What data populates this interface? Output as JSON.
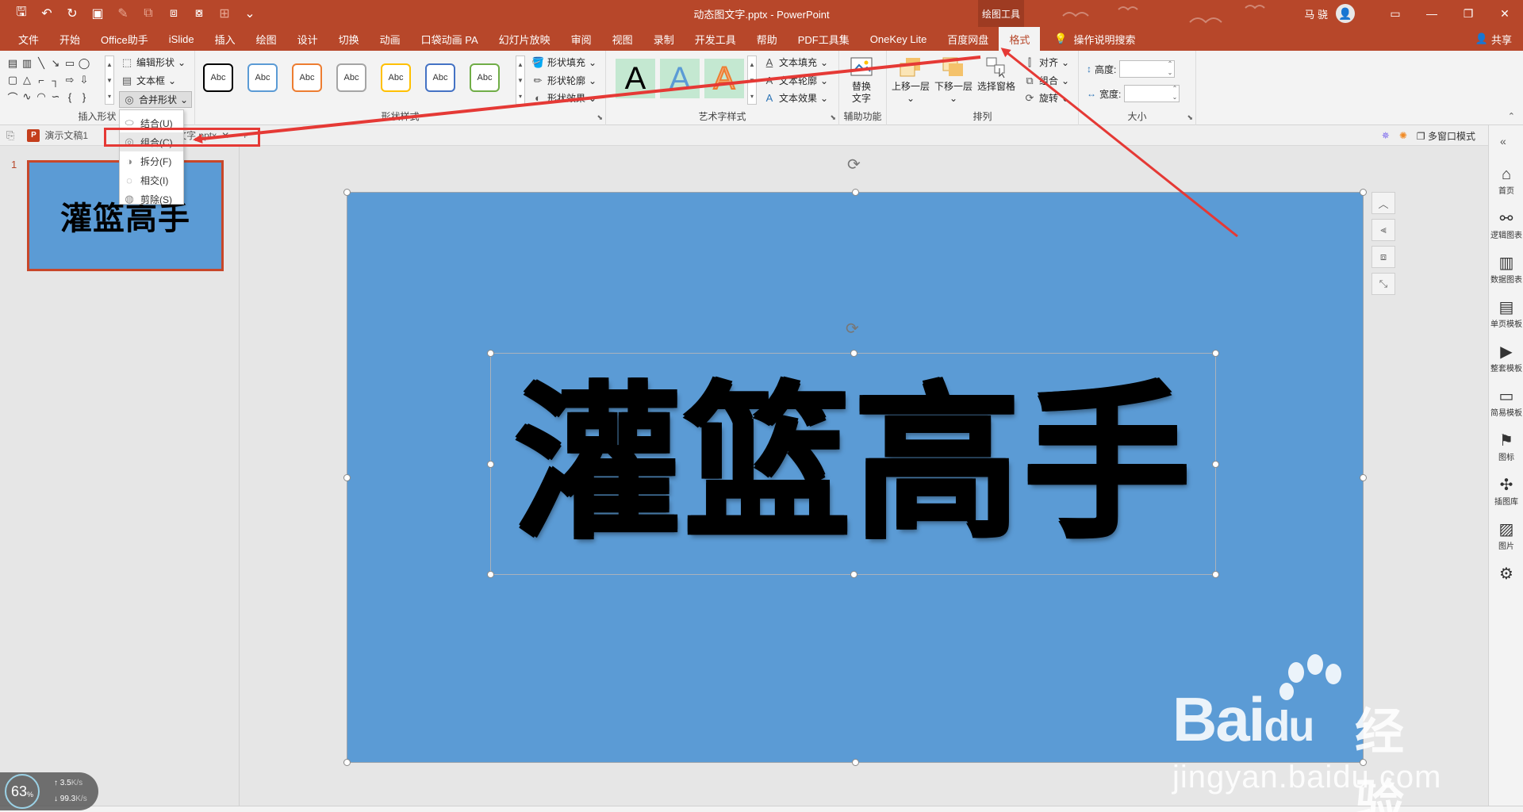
{
  "title": {
    "file": "动态图文字.pptx",
    "app": "PowerPoint",
    "context_tab": "绘图工具"
  },
  "user": {
    "name": "马 骁"
  },
  "tabs": [
    "文件",
    "开始",
    "Office助手",
    "iSlide",
    "插入",
    "绘图",
    "设计",
    "切换",
    "动画",
    "口袋动画 PA",
    "幻灯片放映",
    "审阅",
    "视图",
    "录制",
    "开发工具",
    "帮助",
    "PDF工具集",
    "OneKey Lite",
    "百度网盘",
    "格式"
  ],
  "active_tab": "格式",
  "tell_me": "操作说明搜索",
  "share": "共享",
  "ribbon": {
    "insert_shapes": {
      "label": "插入形状",
      "edit_shape": "编辑形状",
      "text_box": "文本框",
      "merge_shapes": "合并形状"
    },
    "shape_styles": {
      "label": "形状样式",
      "samples": [
        "Abc",
        "Abc",
        "Abc",
        "Abc",
        "Abc",
        "Abc",
        "Abc"
      ],
      "sample_colors": [
        "#000000",
        "#5b9bd5",
        "#ed7d31",
        "#a5a5a5",
        "#ffc000",
        "#4472c4",
        "#70ad47"
      ],
      "fill": "形状填充",
      "outline": "形状轮廓",
      "effects": "形状效果"
    },
    "wordart": {
      "label": "艺术字样式",
      "samples": [
        "A",
        "A",
        "A"
      ],
      "fill": "文本填充",
      "outline": "文本轮廓",
      "effects": "文本效果"
    },
    "accessibility": {
      "label": "辅助功能",
      "alt_text_1": "替换",
      "alt_text_2": "文字"
    },
    "arrange": {
      "label": "排列",
      "bring_forward": "上移一层",
      "send_backward": "下移一层",
      "selection_pane": "选择窗格",
      "align": "对齐",
      "group": "组合",
      "rotate": "旋转"
    },
    "size": {
      "label": "大小",
      "height": "高度:",
      "width": "宽度:"
    }
  },
  "doc_tabs": {
    "current": "演示文稿1",
    "partial": "动态图文字.pptx",
    "multi_window": "多窗口模式"
  },
  "merge_menu": [
    {
      "label": "结合(U)"
    },
    {
      "label": "组合(C)"
    },
    {
      "label": "拆分(F)"
    },
    {
      "label": "相交(I)"
    },
    {
      "label": "剪除(S)"
    }
  ],
  "slide": {
    "number": "1",
    "text": "灌篮高手",
    "background": "#5b9bd5"
  },
  "watermark": {
    "brand": "Bai",
    "brand2": "du",
    "cn": "经验",
    "url": "jingyan.baidu.com"
  },
  "right_pane": [
    "首页",
    "逻辑图表",
    "数据图表",
    "单页模板",
    "整套模板",
    "简易模板",
    "图标",
    "插图库",
    "图片"
  ],
  "gauge": {
    "percent": "63",
    "unit": "%",
    "up": "3.5",
    "up_unit": "K/s",
    "down": "99.3",
    "down_unit": "K/s"
  },
  "colors": {
    "accent": "#b7472a",
    "annotation": "#e53935"
  }
}
